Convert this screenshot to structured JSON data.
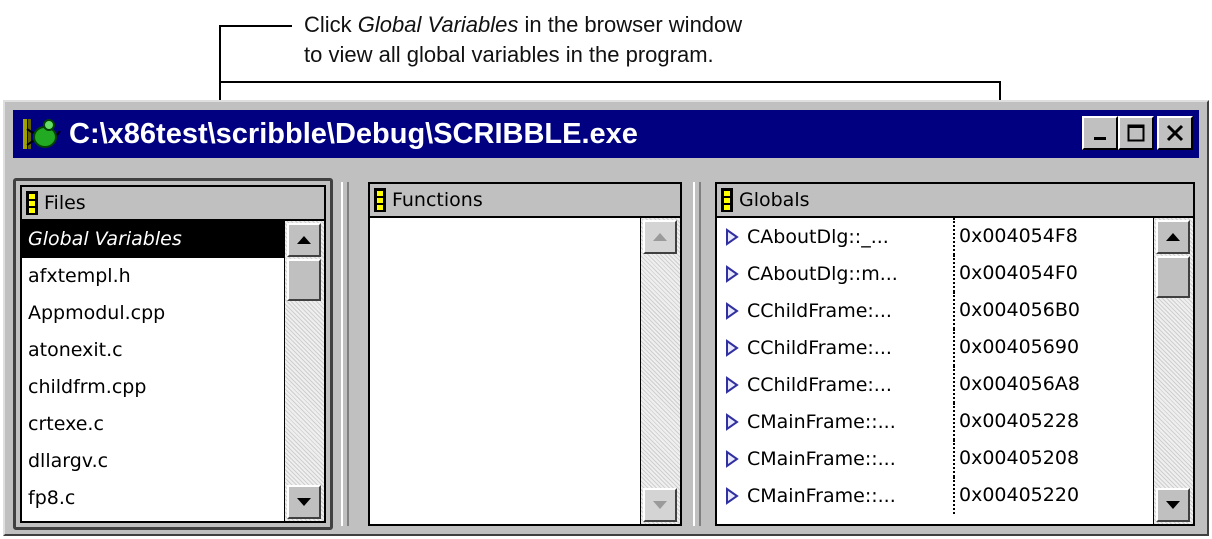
{
  "callout": {
    "prefix": "Click ",
    "emphasis": "Global Variables",
    "suffix": " in the browser window",
    "line2": "to view all global variables in the program."
  },
  "window": {
    "title": "C:\\x86test\\scribble\\Debug\\SCRIBBLE.exe",
    "icon": "bug-app-icon",
    "buttons": [
      "minimize",
      "maximize",
      "close"
    ]
  },
  "files_pane": {
    "header": "Files",
    "items": [
      "Global Variables",
      "afxtempl.h",
      "Appmodul.cpp",
      "atonexit.c",
      "childfrm.cpp",
      "crtexe.c",
      "dllargv.c",
      "fp8.c"
    ],
    "selected_index": 0
  },
  "functions_pane": {
    "header": "Functions",
    "items": []
  },
  "globals_pane": {
    "header": "Globals",
    "rows": [
      {
        "name": "CAboutDlg::_...",
        "address": "0x004054F8"
      },
      {
        "name": "CAboutDlg::m...",
        "address": "0x004054F0"
      },
      {
        "name": "CChildFrame:...",
        "address": "0x004056B0"
      },
      {
        "name": "CChildFrame:...",
        "address": "0x00405690"
      },
      {
        "name": "CChildFrame:...",
        "address": "0x004056A8"
      },
      {
        "name": "CMainFrame::...",
        "address": "0x00405228"
      },
      {
        "name": "CMainFrame::...",
        "address": "0x00405208"
      },
      {
        "name": "CMainFrame::...",
        "address": "0x00405220"
      }
    ]
  },
  "colors": {
    "titlebar": "#000080",
    "window_bg": "#c0c0c0",
    "selection": "#000000"
  }
}
